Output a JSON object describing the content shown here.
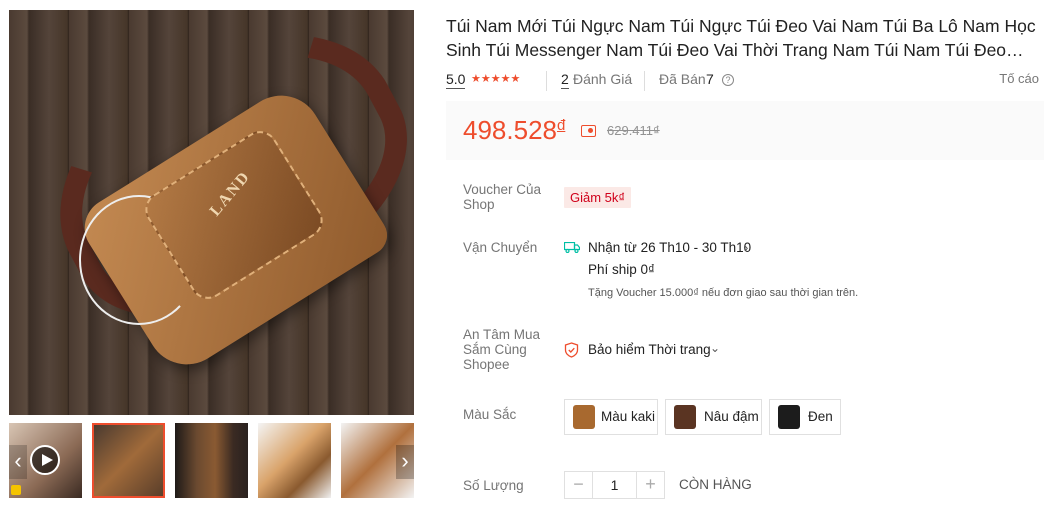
{
  "gallery": {
    "main_image_alt": "LAND",
    "thumbnails": [
      "video",
      "image",
      "image",
      "image",
      "image"
    ],
    "prev_arrow": "‹",
    "next_arrow": "›"
  },
  "product": {
    "title": "Túi Nam Mới Túi Ngực Nam Túi Ngực Túi Đeo Vai Nam Túi Ba Lô Nam Học Sinh Túi Messenger Nam Túi Đeo Vai Thời Trang Nam Túi Nam Túi Đeo Chéo",
    "rating": "5.0",
    "stars": "★★★★★",
    "reviews_count": "2",
    "reviews_label": "Đánh Giá",
    "sold_label": "Đã Bán",
    "sold_count": "7",
    "help_icon": "?",
    "report_label": "Tố cáo"
  },
  "price": {
    "current": "498.528",
    "currency": "đ",
    "original": "629.411₫"
  },
  "voucher": {
    "label": "Voucher Của Shop",
    "badge": "Giảm 5k₫"
  },
  "shipping": {
    "label": "Vận Chuyển",
    "eta": "Nhận từ 26 Th10 - 30 Th10",
    "chevron": "›",
    "fee": "Phí ship 0₫",
    "note": "Tặng Voucher 15.000₫ nếu đơn giao sau thời gian trên."
  },
  "insurance": {
    "label": "An Tâm Mua Sắm Cùng Shopee",
    "text": "Bảo hiểm Thời trang",
    "chevron": "⌄"
  },
  "colors": {
    "label": "Màu Sắc",
    "options": [
      {
        "name": "Màu kaki",
        "swatch": "#a8692f"
      },
      {
        "name": "Nâu đậm",
        "swatch": "#5a3422"
      },
      {
        "name": "Đen",
        "swatch": "#1c1c1c"
      }
    ]
  },
  "quantity": {
    "label": "Số Lượng",
    "minus": "−",
    "value": "1",
    "plus": "+",
    "stock": "CÒN HÀNG"
  },
  "theme": {
    "accent": "#ee4d2d",
    "price_bg": "#fafafa"
  }
}
